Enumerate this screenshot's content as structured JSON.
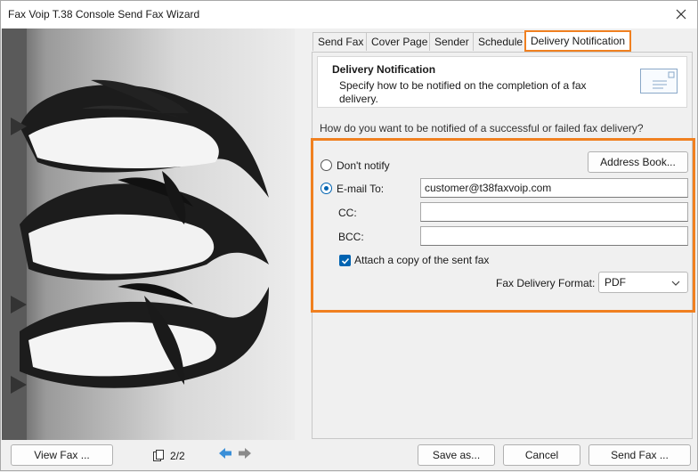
{
  "window": {
    "title": "Fax Voip T.38 Console Send Fax Wizard"
  },
  "tabs": [
    {
      "label": "Send Fax"
    },
    {
      "label": "Cover Page"
    },
    {
      "label": "Sender"
    },
    {
      "label": "Schedule"
    },
    {
      "label": "Delivery Notification",
      "active": true
    }
  ],
  "header": {
    "title": "Delivery Notification",
    "description": "Specify how to be notified on the completion of a fax delivery."
  },
  "question": "How do you want to be notified of a successful or failed fax delivery?",
  "notify": {
    "dont_notify_label": "Don't notify",
    "address_book_label": "Address Book...",
    "email_label": "E-mail To:",
    "email_value": "customer@t38faxvoip.com",
    "cc_label": "CC:",
    "cc_value": "",
    "bcc_label": "BCC:",
    "bcc_value": "",
    "attach_label": "Attach a copy of the sent fax",
    "attach_checked": true,
    "format_label": "Fax Delivery Format:",
    "format_value": "PDF",
    "selected": "email"
  },
  "bottom": {
    "view_fax_label": "View Fax ...",
    "page_indicator": "2/2",
    "save_as_label": "Save as...",
    "cancel_label": "Cancel",
    "send_fax_label": "Send Fax ..."
  },
  "colors": {
    "accent": "#0063b1",
    "highlight": "#f08020"
  }
}
